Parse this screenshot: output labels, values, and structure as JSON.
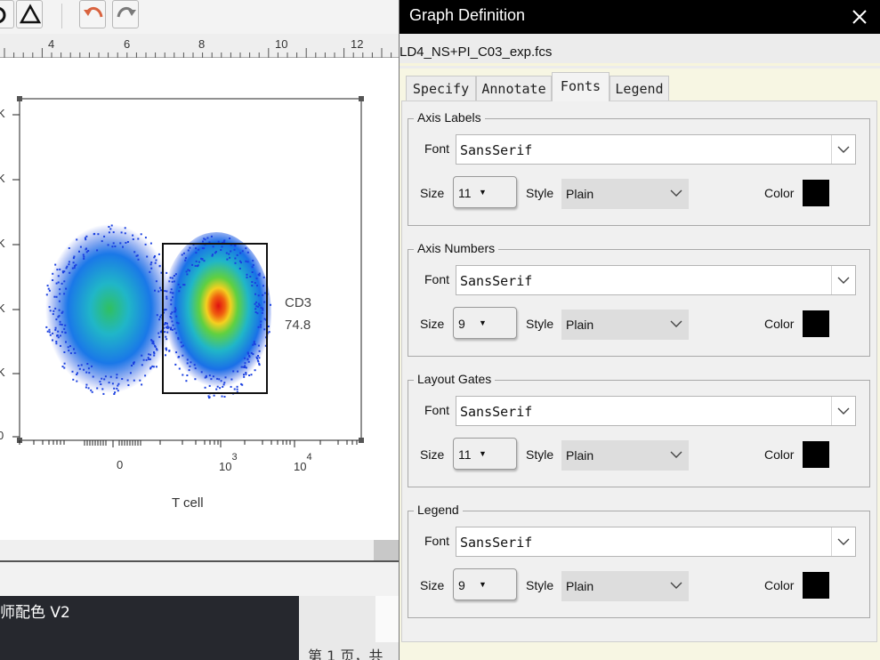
{
  "background_app": {
    "ruler_labels": [
      "4",
      "6",
      "8",
      "10",
      "12"
    ],
    "plot": {
      "gate_label": "CD3",
      "gate_value": "74.8",
      "x_axis_label": "T cell",
      "x_ticks": [
        {
          "base": "0",
          "exp": ""
        },
        {
          "base": "10",
          "exp": "3"
        },
        {
          "base": "10",
          "exp": "4"
        }
      ],
      "y_tick_partial": [
        "K",
        "K",
        "K",
        "K",
        "K",
        "0"
      ]
    },
    "doc_name": "师配色 V2",
    "page_status": "第 1 页，共"
  },
  "dialog": {
    "title": "Graph Definition",
    "filename": "LD4_NS+PI_C03_exp.fcs",
    "tabs": [
      {
        "label": "Specify",
        "active": false
      },
      {
        "label": "Annotate",
        "active": false
      },
      {
        "label": "Fonts",
        "active": true
      },
      {
        "label": "Legend",
        "active": false
      }
    ],
    "labels": {
      "font": "Font",
      "size": "Size",
      "style": "Style",
      "color": "Color"
    },
    "groups": [
      {
        "title": "Axis Labels",
        "font": "SansSerif",
        "size": "11",
        "style": "Plain",
        "color": "#000000"
      },
      {
        "title": "Axis Numbers",
        "font": "SansSerif",
        "size": "9",
        "style": "Plain",
        "color": "#000000"
      },
      {
        "title": "Layout Gates",
        "font": "SansSerif",
        "size": "11",
        "style": "Plain",
        "color": "#000000"
      },
      {
        "title": "Legend",
        "font": "SansSerif",
        "size": "9",
        "style": "Plain",
        "color": "#000000"
      }
    ]
  }
}
